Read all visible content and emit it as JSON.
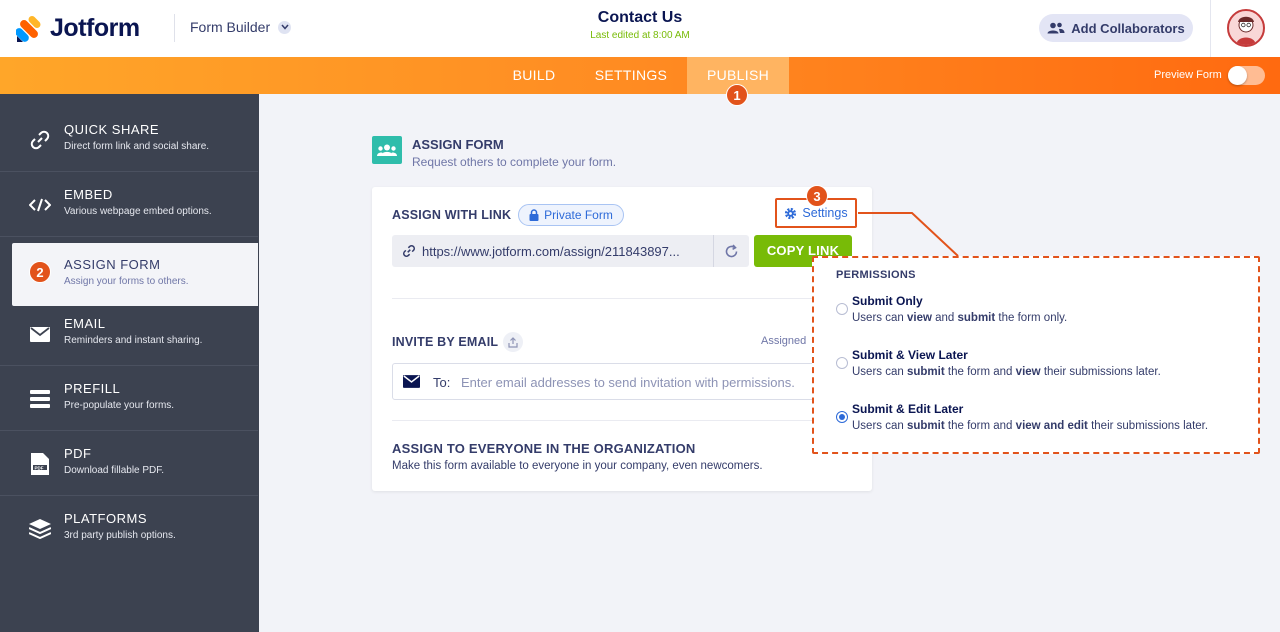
{
  "header": {
    "brand": "Jotform",
    "builder_label": "Form Builder",
    "form_title": "Contact Us",
    "last_edited": "Last edited at 8:00 AM",
    "collab_label": "Add Collaborators"
  },
  "nav": {
    "tabs": [
      {
        "label": "BUILD"
      },
      {
        "label": "SETTINGS"
      },
      {
        "label": "PUBLISH"
      }
    ],
    "preview_label": "Preview Form",
    "preview_on": false
  },
  "badges": [
    "1",
    "2",
    "3"
  ],
  "sidebar": {
    "items": [
      {
        "label": "QUICK SHARE",
        "sub": "Direct form link and social share.",
        "icon": "link-icon"
      },
      {
        "label": "EMBED",
        "sub": "Various webpage embed options.",
        "icon": "code-icon"
      },
      {
        "label": "ASSIGN FORM",
        "sub": "Assign your forms to others.",
        "icon": "badge"
      },
      {
        "label": "EMAIL",
        "sub": "Reminders and instant sharing.",
        "icon": "envelope-icon"
      },
      {
        "label": "PREFILL",
        "sub": "Pre-populate your forms.",
        "icon": "prefill-icon"
      },
      {
        "label": "PDF",
        "sub": "Download fillable PDF.",
        "icon": "pdf-icon"
      },
      {
        "label": "PLATFORMS",
        "sub": "3rd party publish options.",
        "icon": "layers-icon"
      }
    ]
  },
  "assign": {
    "title": "ASSIGN FORM",
    "subtitle": "Request others to complete your form.",
    "link_section": "ASSIGN WITH LINK",
    "private_label": "Private Form",
    "settings_label": "Settings",
    "url": "https://www.jotform.com/assign/211843897...",
    "copy_label": "COPY LINK",
    "invite_section": "INVITE BY EMAIL",
    "assigned_label": "Assigned",
    "to_label": "To:",
    "email_placeholder": "Enter email addresses to send invitation with permissions.",
    "org_title": "ASSIGN TO EVERYONE IN THE ORGANIZATION",
    "org_sub": "Make this form available to everyone in your company, even newcomers."
  },
  "permissions": {
    "title": "PERMISSIONS",
    "options": [
      {
        "title": "Submit Only",
        "selected": false
      },
      {
        "title": "Submit & View Later",
        "selected": false
      },
      {
        "title": "Submit & Edit Later",
        "selected": true
      }
    ],
    "desc_words": {
      "users_can": "Users can",
      "view": "view",
      "and": "and",
      "submit": "submit",
      "form_only": "the form only.",
      "the_form_and": "the form and",
      "their_later": "their submissions later.",
      "view_and_edit": "view and edit"
    }
  },
  "colors": {
    "accent": "#ff6100",
    "callout": "#e2531b",
    "green": "#78bb07",
    "link_blue": "#2d6ad8",
    "sidebar_bg": "#3c4250"
  }
}
